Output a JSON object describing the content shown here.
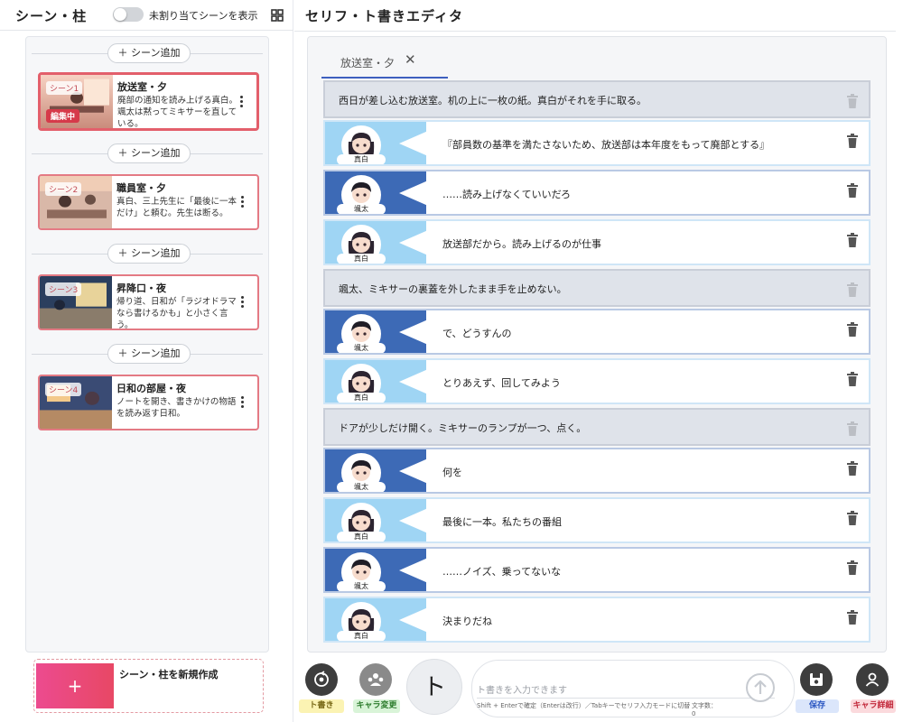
{
  "left": {
    "title": "シーン・柱",
    "toggle_label": "未割り当てシーンを表示",
    "add_scene_label": "＋ シーン追加",
    "scenes": [
      {
        "tag": "シーン1",
        "title": "放送室・夕",
        "desc": "廃部の通知を読み上げる真白。颯太は黙ってミキサーを直している。",
        "badge": "編集中"
      },
      {
        "tag": "シーン2",
        "title": "職員室・夕",
        "desc": "真白、三上先生に「最後に一本だけ」と頼む。先生は断る。",
        "badge": ""
      },
      {
        "tag": "シーン3",
        "title": "昇降口・夜",
        "desc": "帰り道、日和が「ラジオドラマなら書けるかも」と小さく言う。",
        "badge": ""
      },
      {
        "tag": "シーン4",
        "title": "日和の部屋・夜",
        "desc": "ノートを開き、書きかけの物語を読み返す日和。",
        "badge": ""
      }
    ],
    "new_label": "シーン・柱を新規作成",
    "new_plus": "+"
  },
  "right": {
    "title": "セリフ・ト書きエディタ",
    "tab_label": "放送室・夕",
    "tab_close": "✕",
    "rows": [
      {
        "kind": "action",
        "text": "西日が差し込む放送室。机の上に一枚の紙。真白がそれを手に取る。"
      },
      {
        "kind": "dialogue",
        "char": "mashiro",
        "name": "真白",
        "text": "『部員数の基準を満たさないため、放送部は本年度をもって廃部とする』"
      },
      {
        "kind": "dialogue",
        "char": "souta",
        "name": "颯太",
        "text": "……読み上げなくていいだろ"
      },
      {
        "kind": "dialogue",
        "char": "mashiro",
        "name": "真白",
        "text": "放送部だから。読み上げるのが仕事"
      },
      {
        "kind": "action",
        "text": "颯太、ミキサーの裏蓋を外したまま手を止めない。"
      },
      {
        "kind": "dialogue",
        "char": "souta",
        "name": "颯太",
        "text": "で、どうすんの"
      },
      {
        "kind": "dialogue",
        "char": "mashiro",
        "name": "真白",
        "text": "とりあえず、回してみよう"
      },
      {
        "kind": "action",
        "text": "ドアが少しだけ開く。ミキサーのランプが一つ、点く。"
      },
      {
        "kind": "dialogue",
        "char": "souta",
        "name": "颯太",
        "text": "何を"
      },
      {
        "kind": "dialogue",
        "char": "mashiro",
        "name": "真白",
        "text": "最後に一本。私たちの番組"
      },
      {
        "kind": "dialogue",
        "char": "souta",
        "name": "颯太",
        "text": "……ノイズ、乗ってないな"
      },
      {
        "kind": "dialogue",
        "char": "mashiro",
        "name": "真白",
        "text": "決まりだね"
      }
    ]
  },
  "bottom": {
    "togaki_label": "ト書き",
    "chara_change_label": "キャラ変更",
    "big_button": "ト",
    "input_placeholder": "ト書きを入力できます",
    "hint": "Shift + Enterで確定（Enterは改行）／Tabキーでセリフ入力モードに切替",
    "char_count_label": "文字数：",
    "char_count_value": "0",
    "save_label": "保存",
    "chara_detail_label": "キャラ詳細"
  },
  "colors": {
    "accent_pink": "#e84865",
    "card_border": "#e47a84",
    "mashiro_row": "#9fd5f4",
    "souta_row": "#3d6ab6",
    "tab_underline": "#3d5fbf"
  }
}
